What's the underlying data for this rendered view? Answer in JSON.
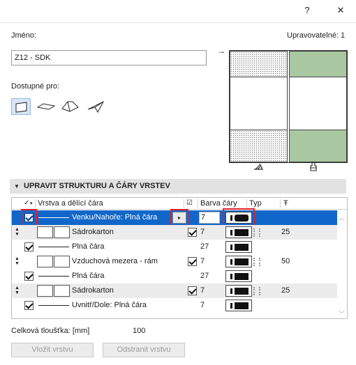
{
  "window": {
    "help_label": "?",
    "close_label": "✕"
  },
  "name": {
    "label": "Jméno:",
    "value": "Z12 - SDK"
  },
  "editable": {
    "label": "Upravovatelné: 1"
  },
  "available": {
    "label": "Dostupné pro:",
    "tools": [
      "wall-tool",
      "slab-tool",
      "roof-tool",
      "shell-tool"
    ],
    "selected": "wall-tool"
  },
  "preview": {
    "pointer": "→",
    "icons": [
      "cut-fill-icon",
      "surface-paint-icon"
    ]
  },
  "section": {
    "title": "UPRAVIT STRUKTURU A ČÁRY VRSTEV",
    "collapse_icon": "▼"
  },
  "table": {
    "headers": {
      "layer": "Vrstva a dělící čára",
      "pen": "Barva čáry",
      "type": "Typ",
      "thickness_icon": "Ŧ"
    },
    "rows": [
      {
        "kind": "line",
        "selected": true,
        "name": "Venku/Nahoře: Plná čára",
        "pen": "7",
        "pen_visible": true
      },
      {
        "kind": "layer",
        "name": "Sádrokarton",
        "pen": "7",
        "thickness": "25",
        "fill": [
          "dots",
          "green"
        ]
      },
      {
        "kind": "line",
        "name": "Plná čára",
        "pen": "27"
      },
      {
        "kind": "layer",
        "name": "Vzduchová mezera - rám",
        "pen": "7",
        "thickness": "50",
        "fill": [
          "white",
          "white"
        ]
      },
      {
        "kind": "line",
        "name": "Plná čára",
        "pen": "27"
      },
      {
        "kind": "layer",
        "name": "Sádrokarton",
        "pen": "7",
        "thickness": "25",
        "fill": [
          "dots",
          "green"
        ]
      },
      {
        "kind": "line",
        "name": "Uvnitř/Dole: Plná čára",
        "pen": "7"
      }
    ]
  },
  "total": {
    "label": "Celková tloušťka: [mm]",
    "value": "100"
  },
  "buttons": {
    "insert": "Vložit vrstvu",
    "remove": "Odstranit vrstvu"
  },
  "colors": {
    "selection": "#1167c9",
    "highlight": "#e0202a",
    "fill_green": "#a9c7a1"
  }
}
